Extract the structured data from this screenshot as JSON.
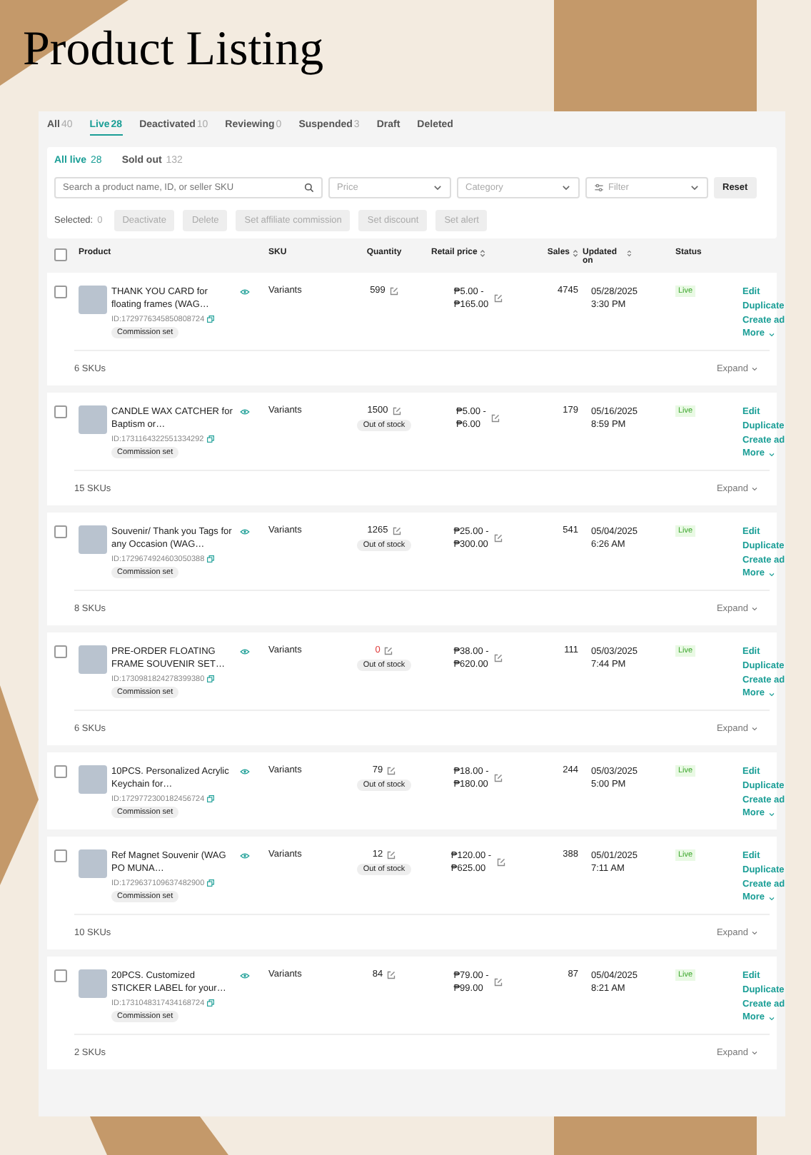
{
  "page_title": "Product Listing",
  "tabs": [
    {
      "label": "All",
      "count": "40",
      "selected": false
    },
    {
      "label": "Live",
      "count": "28",
      "selected": true
    },
    {
      "label": "Deactivated",
      "count": "10",
      "selected": false
    },
    {
      "label": "Reviewing",
      "count": "0",
      "selected": false
    },
    {
      "label": "Suspended",
      "count": "3",
      "selected": false
    },
    {
      "label": "Draft",
      "selected": false
    },
    {
      "label": "Deleted",
      "selected": false
    }
  ],
  "subtabs": [
    {
      "label": "All live",
      "count": "28",
      "selected": true
    },
    {
      "label": "Sold out",
      "count": "132",
      "selected": false
    }
  ],
  "search": {
    "placeholder": "Search a product name, ID, or seller SKU"
  },
  "dropdowns": [
    {
      "placeholder": "Price"
    },
    {
      "placeholder": "Category"
    },
    {
      "placeholder": "Filter"
    }
  ],
  "reset_button": "Reset",
  "selected_label": "Selected:",
  "selected_count": "0",
  "bulk_actions": [
    {
      "label": "Deactivate",
      "disabled": true
    },
    {
      "label": "Delete",
      "disabled": true
    },
    {
      "label": "Set affiliate commission",
      "disabled": true
    },
    {
      "label": "Set discount",
      "disabled": true
    },
    {
      "label": "Set alert",
      "disabled": true
    }
  ],
  "select_all_checked": false,
  "columns": [
    {
      "label": "Product",
      "sortable": false
    },
    {
      "label": "SKU",
      "sortable": false
    },
    {
      "label": "Quantity",
      "sortable": false
    },
    {
      "label": "Retail price",
      "sortable": true
    },
    {
      "label": "Sales",
      "sortable": true
    },
    {
      "label": "Updated on",
      "sortable": true
    },
    {
      "label": "Status",
      "sortable": false
    }
  ],
  "rows": [
    {
      "name": "THANK YOU CARD for floating frames (WAG…",
      "id": "ID:1729776345850808724",
      "tag": "Commission set",
      "sku": "Variants",
      "quantity": "599",
      "quantity_zero": false,
      "out_of_stock": false,
      "price_from": "₱5.00 -",
      "price_to": "₱165.00",
      "sales": "4745",
      "date": "05/28/2025",
      "time": "3:30 PM",
      "status": "Live",
      "actions": [
        "Edit",
        "Duplicate",
        "Create ad",
        "More"
      ],
      "sku_count": "6 SKUs",
      "expand": "Expand",
      "checked": false
    },
    {
      "name": "CANDLE WAX CATCHER for Baptism or…",
      "id": "ID:1731164322551334292",
      "tag": "Commission set",
      "sku": "Variants",
      "quantity": "1500",
      "quantity_zero": false,
      "out_of_stock": true,
      "out_of_stock_label": "Out of stock",
      "price_from": "₱5.00 -",
      "price_to": "₱6.00",
      "sales": "179",
      "date": "05/16/2025",
      "time": "8:59 PM",
      "status": "Live",
      "actions": [
        "Edit",
        "Duplicate",
        "Create ad",
        "More"
      ],
      "sku_count": "15 SKUs",
      "expand": "Expand",
      "checked": false
    },
    {
      "name": "Souvenir/ Thank you Tags for any Occasion (WAG…",
      "id": "ID:1729674924603050388",
      "tag": "Commission set",
      "sku": "Variants",
      "quantity": "1265",
      "quantity_zero": false,
      "out_of_stock": true,
      "out_of_stock_label": "Out of stock",
      "price_from": "₱25.00 -",
      "price_to": "₱300.00",
      "sales": "541",
      "date": "05/04/2025",
      "time": "6:26 AM",
      "status": "Live",
      "actions": [
        "Edit",
        "Duplicate",
        "Create ad",
        "More"
      ],
      "sku_count": "8 SKUs",
      "expand": "Expand",
      "checked": false
    },
    {
      "name": "PRE-ORDER FLOATING FRAME SOUVENIR SET…",
      "id": "ID:1730981824278399380",
      "tag": "Commission set",
      "sku": "Variants",
      "quantity": "0",
      "quantity_zero": true,
      "out_of_stock": true,
      "out_of_stock_label": "Out of stock",
      "price_from": "₱38.00 -",
      "price_to": "₱620.00",
      "sales": "111",
      "date": "05/03/2025",
      "time": "7:44 PM",
      "status": "Live",
      "actions": [
        "Edit",
        "Duplicate",
        "Create ad",
        "More"
      ],
      "sku_count": "6 SKUs",
      "expand": "Expand",
      "checked": false
    },
    {
      "name": "10PCS. Personalized Acrylic Keychain for…",
      "id": "ID:1729772300182456724",
      "tag": "Commission set",
      "sku": "Variants",
      "quantity": "79",
      "quantity_zero": false,
      "out_of_stock": true,
      "out_of_stock_label": "Out of stock",
      "price_from": "₱18.00 -",
      "price_to": "₱180.00",
      "sales": "244",
      "date": "05/03/2025",
      "time": "5:00 PM",
      "status": "Live",
      "actions": [
        "Edit",
        "Duplicate",
        "Create ad",
        "More"
      ],
      "checked": false
    },
    {
      "name": "Ref Magnet Souvenir (WAG PO MUNA…",
      "id": "ID:1729637109637482900",
      "tag": "Commission set",
      "sku": "Variants",
      "quantity": "12",
      "quantity_zero": false,
      "out_of_stock": true,
      "out_of_stock_label": "Out of stock",
      "price_from": "₱120.00 -",
      "price_to": "₱625.00",
      "sales": "388",
      "date": "05/01/2025",
      "time": "7:11 AM",
      "status": "Live",
      "actions": [
        "Edit",
        "Duplicate",
        "Create ad",
        "More"
      ],
      "sku_count": "10 SKUs",
      "expand": "Expand",
      "checked": false
    },
    {
      "name": "20PCS. Customized STICKER LABEL for your…",
      "id": "ID:1731048317434168724",
      "tag": "Commission set",
      "sku": "Variants",
      "quantity": "84",
      "quantity_zero": false,
      "out_of_stock": false,
      "price_from": "₱79.00 -",
      "price_to": "₱99.00",
      "sales": "87",
      "date": "05/04/2025",
      "time": "8:21 AM",
      "status": "Live",
      "actions": [
        "Edit",
        "Duplicate",
        "Create ad",
        "More"
      ],
      "sku_count": "2 SKUs",
      "expand": "Expand",
      "checked": false
    }
  ]
}
